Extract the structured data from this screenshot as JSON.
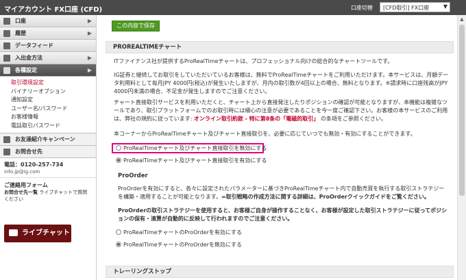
{
  "header": {
    "title": "マイアカウント FX口座 (CFD)",
    "account_switch_label": "口座切替",
    "account_selected": "[CFD取引] FX口座"
  },
  "sidebar": {
    "items": [
      {
        "label": "口座",
        "icon": "account-icon"
      },
      {
        "label": "履歴",
        "icon": "history-icon"
      },
      {
        "label": "データフィード",
        "icon": "datafeed-icon"
      },
      {
        "label": "入出金方法",
        "icon": "deposit-icon"
      },
      {
        "label": "各種設定",
        "icon": "gear-icon"
      }
    ],
    "submenu": [
      "取引環境設定",
      "バイナリーオプション",
      "通知設定",
      "ユーザー名/パスワード",
      "お客様情報",
      "電話取引パスワード"
    ],
    "referral": "お友達紹介キャンペーン",
    "contact": "お問合せ先",
    "tel": "電話：0120-257-734",
    "mail": "info.jp@ig.com",
    "form_title": "ご連絡用フォーム",
    "note_bold": "お問合せ先一覧",
    "note_rest": " ライブチャットで質問ください",
    "chat_label": "ライブチャット"
  },
  "main": {
    "save_label": "この内容で保存",
    "section1_title": "PROREALTIMEチャート",
    "p1": "ITファイナンス社が提供するProRealTimeチャートは、プロフェッショナル向けの総合的なチャートツールです。",
    "p2": "IG証券と継続してお取引をしていただいているお客様は、無料でProRealTimeチャートをご利用いただけます。本サービスは、月額データ利用料として毎月JPY 4000円(税込)が発生いたしますが、月内の取引数が4回以上の場合、無料となります。※請求時に口座残高がJPY 4000円未満の場合、不足金が発生しますのでご注意ください。",
    "p3a": "チャート直接取引サービスを利用いただくと、チャート上から直接発注したりポジションの確認が可能となりますが、本機能は複雑なツールであり、取引プラットフォームでのお取引時には細心の注意が必要であることを今一度ご確認下さい。お客様の本サービスのご利用は、弊社の規約に従っています: ",
    "p3b": "オンライン取引約款 - 特に第8条の「電磁的取引」",
    "p3c": " の条項をご参照ください。",
    "p4": "本コーナーからProRealTimeチャート及びチャート直接取引を、必要に応じていつでも無効・有効にすることができます。",
    "radio1": "ProRealTimeチャート及びチャート直接取引を無効にする",
    "radio2": "ProRealTimeチャート及びチャート直接取引を有効にする",
    "proorder_title": "ProOrder",
    "p5a": "ProOrderを有効にすると、各々に設定されたパラメーターに基づきProRealTimeチャート内で自動売買を執行する取引ストラテジーを構築・適用することが可能となります。",
    "p5b": "=取引戦略の作成方法に関する詳細は、ProOrderクイックガイドをご覧ください。",
    "p6": "ProOrderの取引ストラテジーを使用すると、お客様ご自身が操作することなく、お客様が設定した取引ストラテジーに従ってポジションの保有・清算が自動的に反映して行われますのでご注意ください。",
    "radio3": "ProRealTimeチャートのProOrderを有効にする",
    "radio4": "ProRealTimeチャートのProOrderを無効にする",
    "section2_title": "トレーリングストップ"
  }
}
